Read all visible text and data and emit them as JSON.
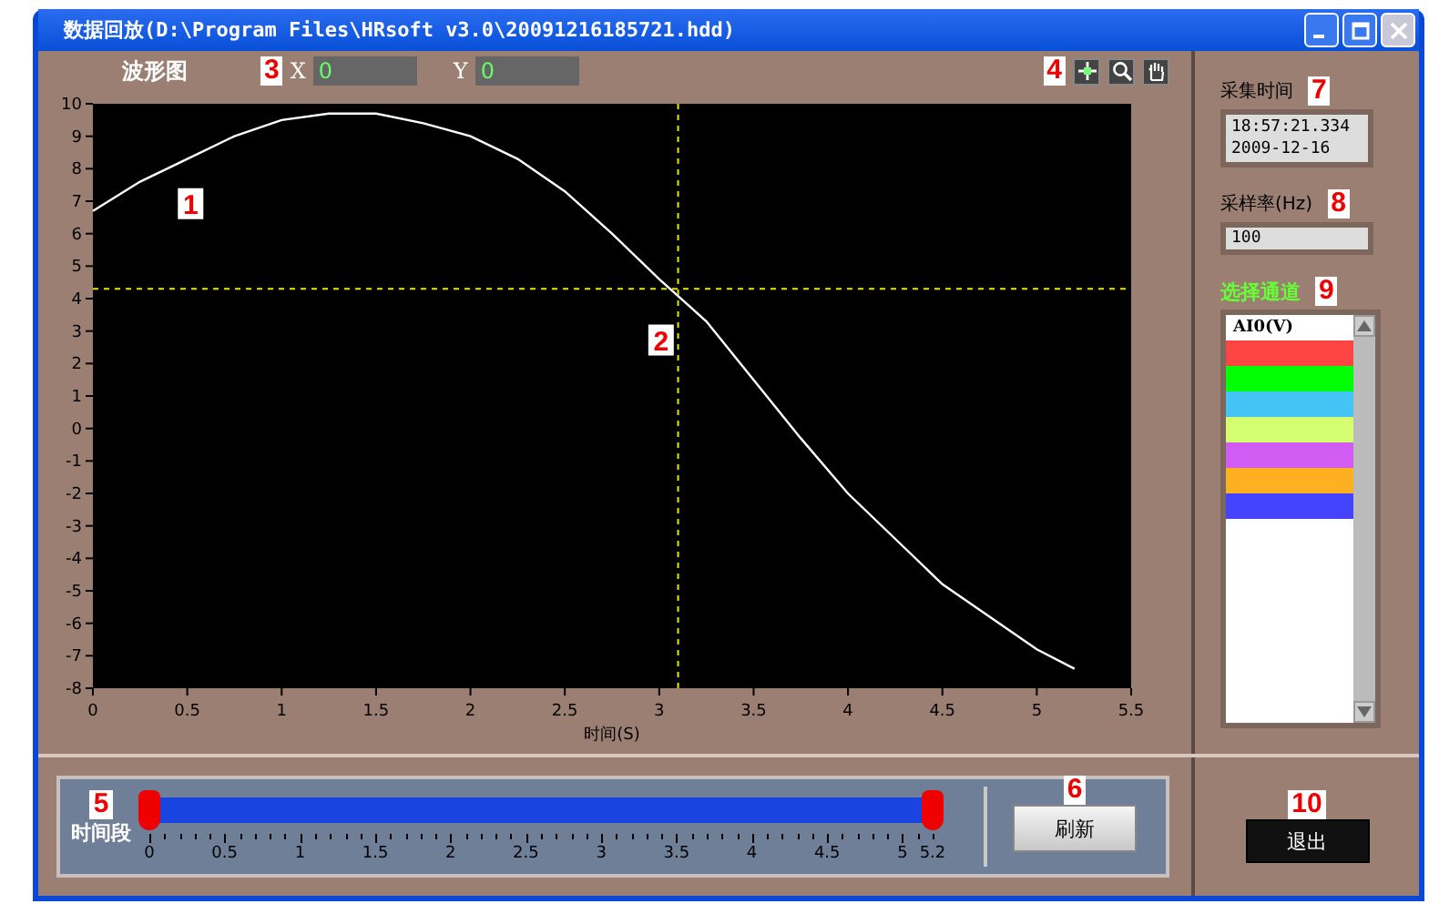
{
  "window": {
    "title": "数据回放(D:\\Program Files\\HRsoft v3.0\\20091216185721.hdd)"
  },
  "graph": {
    "title": "波形图",
    "callout": "3",
    "x_label": "X",
    "x_value": "0",
    "y_label": "Y",
    "y_value": "0",
    "tools_callout": "4",
    "plot_callouts": [
      "1",
      "2"
    ],
    "chart_data": {
      "type": "line",
      "xlabel": "时间(S)",
      "xlim": [
        0,
        5.5
      ],
      "ylim": [
        -8,
        10
      ],
      "xticks": [
        0,
        0.5,
        1,
        1.5,
        2,
        2.5,
        3,
        3.5,
        4,
        4.5,
        5,
        5.5
      ],
      "yticks": [
        -8,
        -7,
        -6,
        -5,
        -4,
        -3,
        -2,
        -1,
        0,
        1,
        2,
        3,
        4,
        5,
        6,
        7,
        8,
        9,
        10
      ],
      "x": [
        0,
        0.25,
        0.5,
        0.75,
        1,
        1.25,
        1.5,
        1.75,
        2,
        2.25,
        2.5,
        2.75,
        3,
        3.25,
        3.5,
        3.75,
        4,
        4.25,
        4.5,
        4.75,
        5,
        5.2
      ],
      "series": [
        {
          "color": "#ffffff",
          "values": [
            6.7,
            7.6,
            8.3,
            9.0,
            9.5,
            9.7,
            9.7,
            9.4,
            9.0,
            8.3,
            7.3,
            6.0,
            4.6,
            3.3,
            1.5,
            -0.3,
            -2.0,
            -3.4,
            -4.8,
            -5.8,
            -6.8,
            -7.4
          ]
        }
      ]
    }
  },
  "acquire": {
    "label": "采集时间",
    "callout": "7",
    "lines": [
      "18:57:21.334",
      "2009-12-16"
    ]
  },
  "rate": {
    "label": "采样率(Hz)",
    "callout": "8",
    "value": "100"
  },
  "channels": {
    "label": "选择通道",
    "callout": "9",
    "items": [
      {
        "label": "AI0(V)"
      },
      {
        "color": "#ff4444"
      },
      {
        "color": "#00ff00"
      },
      {
        "color": "#44c4f4"
      },
      {
        "color": "#d4ff70"
      },
      {
        "color": "#d05cf4"
      },
      {
        "color": "#ffb020"
      },
      {
        "color": "#4444ff"
      }
    ]
  },
  "range": {
    "label": "时间段",
    "callout": "5",
    "low": {
      "level": 0
    },
    "high": {
      "level": 1
    },
    "ticks": [
      "0",
      "0.5",
      "1",
      "1.5",
      "2",
      "2.5",
      "3",
      "3.5",
      "4",
      "4.5",
      "5",
      "5.2"
    ]
  },
  "refresh": {
    "label": "刷新",
    "callout": "6"
  },
  "exit": {
    "label": "退出",
    "callout": "10"
  }
}
